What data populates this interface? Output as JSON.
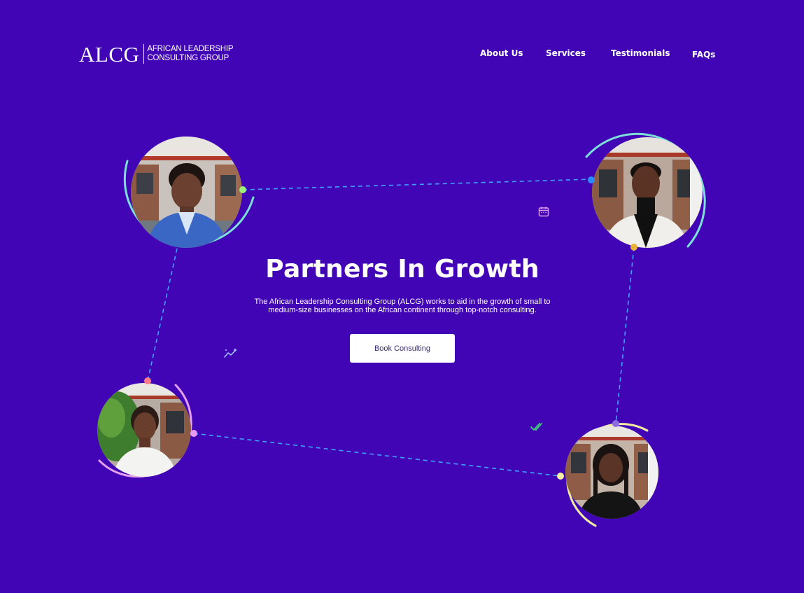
{
  "header": {
    "logo_mark": "ALCG",
    "logo_line1": "AFRICAN LEADERSHIP",
    "logo_line2": "CONSULTING GROUP"
  },
  "nav": {
    "items": [
      {
        "label": "About Us"
      },
      {
        "label": "Services"
      },
      {
        "label": "Testimonials"
      },
      {
        "label": "FAQs"
      }
    ]
  },
  "hero": {
    "title": "Partners In Growth",
    "description": "The African Leadership Consulting Group (ALCG) works  to aid in the growth of small to medium-size businesses  on the African continent through top-notch consulting.",
    "cta_label": "Book Consulting"
  },
  "icons": {
    "calendar": "calendar-icon",
    "trend": "sparkle-trend-icon",
    "check": "double-check-icon"
  },
  "colors": {
    "background": "#4105b6",
    "ring_teal": "#7de0d8",
    "ring_pink": "#e6a0f0",
    "ring_yellow": "#f3ee9e",
    "dash_blue": "#3fa2ff",
    "dot_green": "#9cf07a",
    "dot_blue": "#2d8bff",
    "dot_gold": "#e8b23a",
    "dot_coral": "#ff7a8a",
    "dot_pink": "#e89bf5",
    "dot_violet": "#8a6ee0",
    "dot_yellow": "#f6f1a0"
  }
}
